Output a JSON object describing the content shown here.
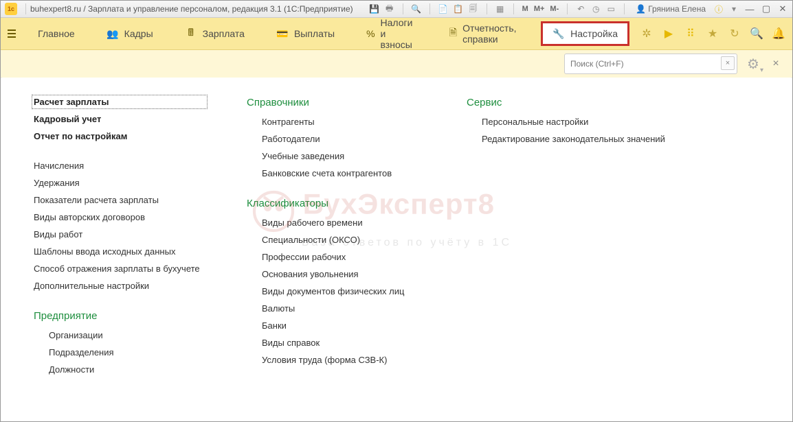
{
  "title": "buhexpert8.ru / Зарплата и управление персоналом, редакция 3.1  (1С:Предприятие)",
  "user": "Грянина Елена",
  "toolbar_chars": {
    "m": "M",
    "mplus": "M+",
    "mminus": "M-"
  },
  "menu": {
    "main": "Главное",
    "kadry": "Кадры",
    "zarplata": "Зарплата",
    "vyplaty": "Выплаты",
    "nalogi": "Налоги и взносы",
    "otchet": "Отчетность, справки",
    "nastroyka": "Настройка"
  },
  "search_placeholder": "Поиск (Ctrl+F)",
  "col1": {
    "top": [
      "Расчет зарплаты",
      "Кадровый учет",
      "Отчет по настройкам"
    ],
    "mid": [
      "Начисления",
      "Удержания",
      "Показатели расчета зарплаты",
      "Виды авторских договоров",
      "Виды работ",
      "Шаблоны ввода исходных данных",
      "Способ отражения зарплаты в бухучете",
      "Дополнительные настройки"
    ],
    "sec2": "Предприятие",
    "pred": [
      "Организации",
      "Подразделения",
      "Должности"
    ]
  },
  "col2": {
    "sec1": "Справочники",
    "s1": [
      "Контрагенты",
      "Работодатели",
      "Учебные заведения",
      "Банковские счета контрагентов"
    ],
    "sec2": "Классификаторы",
    "s2": [
      "Виды рабочего времени",
      "Специальности (ОКСО)",
      "Профессии рабочих",
      "Основания увольнения",
      "Виды документов физических лиц",
      "Валюты",
      "Банки",
      "Виды справок",
      "Условия труда (форма СЗВ-К)"
    ]
  },
  "col3": {
    "sec": "Сервис",
    "items": [
      "Персональные настройки",
      "Редактирование законодательных значений"
    ]
  },
  "watermark": {
    "big": "БухЭксперт8",
    "sub": "База ответов по учёту в 1С"
  }
}
